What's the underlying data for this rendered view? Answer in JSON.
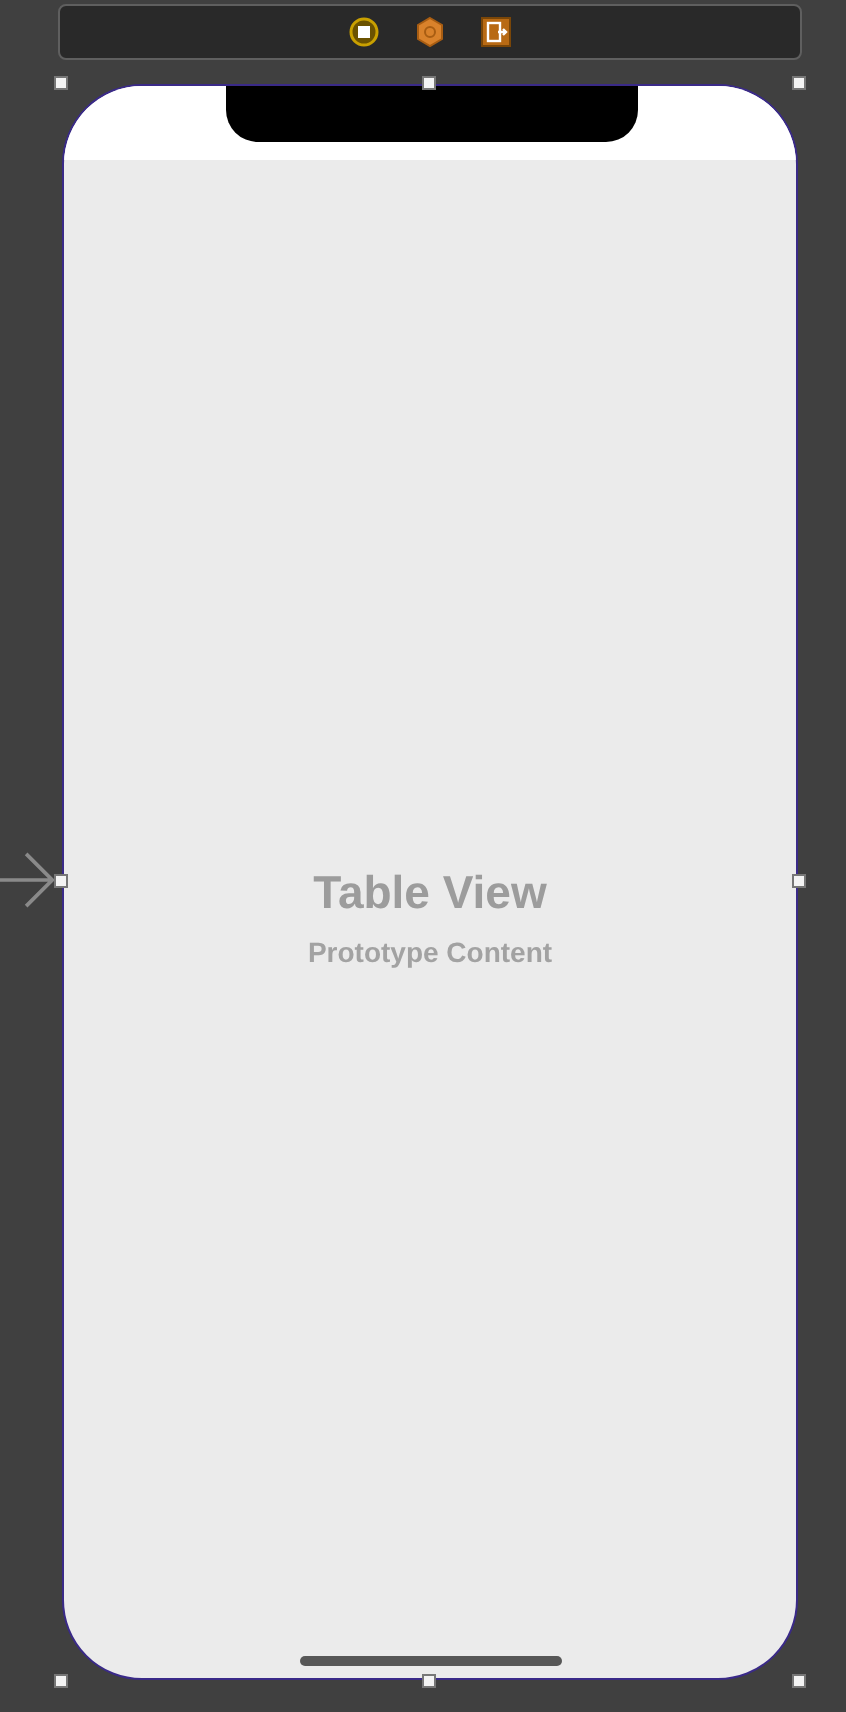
{
  "table_view": {
    "title": "Table View",
    "subtitle": "Prototype Content"
  }
}
